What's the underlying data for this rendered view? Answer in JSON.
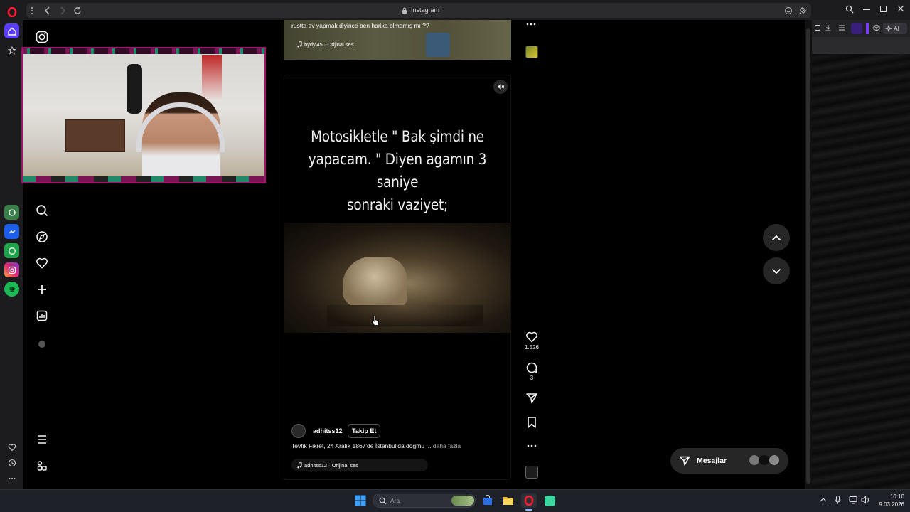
{
  "browser": {
    "tab_title": "Instagram",
    "side_panel_ai_label": "AI"
  },
  "top_reel": {
    "caption": "rustta ev yapmak diyince ben harika olmamış mı ??",
    "audio": "hydy.45 · Orijinal ses"
  },
  "main_reel": {
    "overlay_text_line1": "Motosikletle \" Bak şimdi ne",
    "overlay_text_line2": "yapacam. \" Diyen agamın 3 saniye",
    "overlay_text_line3": "sonraki vaziyet;",
    "username": "adhitss12",
    "follow_label": "Takip Et",
    "description": "Tevfik Fikret, 24 Aralık 1867'de İstanbul'da doğmu ...",
    "more_label": "daha fazla",
    "audio": "adhitss12 · Orijinal ses",
    "likes": "1.526",
    "comments": "3"
  },
  "messages": {
    "label": "Mesajlar"
  },
  "taskbar": {
    "search_placeholder": "Ara",
    "time": "10:10",
    "date": "9.03.2026"
  },
  "colors": {
    "opera_red": "#ff1b2d",
    "webcam_border": "#a0146a",
    "accent_purple": "#5b3cff",
    "background": "#000000"
  }
}
